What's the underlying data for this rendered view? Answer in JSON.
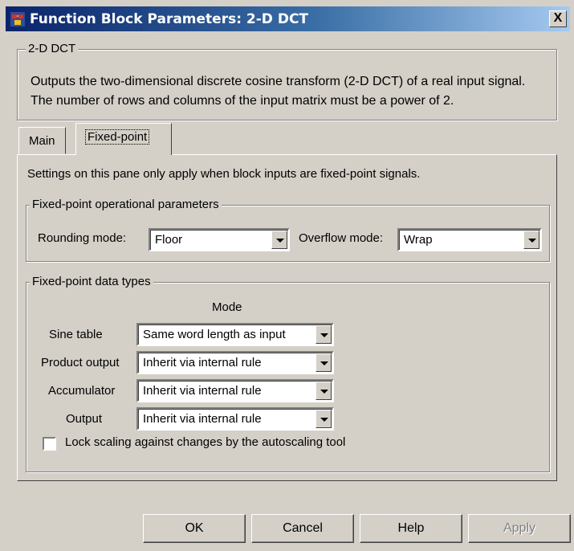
{
  "window": {
    "title": "Function Block Parameters: 2-D DCT",
    "close_label": "X"
  },
  "block": {
    "group_label": "2-D DCT",
    "description_line1": "Outputs the two-dimensional discrete cosine transform (2-D DCT) of a real input signal.",
    "description_line2": "The number of rows and columns of the input matrix must be a power of 2."
  },
  "tabs": [
    {
      "label": "Main",
      "active": false
    },
    {
      "label": "Fixed-point",
      "active": true
    }
  ],
  "pane": {
    "note": "Settings on this pane only apply when block inputs are fixed-point signals.",
    "operational": {
      "group_label": "Fixed-point operational parameters",
      "rounding_label": "Rounding mode:",
      "rounding_value": "Floor",
      "overflow_label": "Overflow mode:",
      "overflow_value": "Wrap"
    },
    "datatypes": {
      "group_label": "Fixed-point data types",
      "mode_header": "Mode",
      "rows": [
        {
          "label": "Sine table",
          "value": "Same word length as input"
        },
        {
          "label": "Product output",
          "value": "Inherit via internal rule"
        },
        {
          "label": "Accumulator",
          "value": "Inherit via internal rule"
        },
        {
          "label": "Output",
          "value": "Inherit via internal rule"
        }
      ],
      "lock_label": "Lock scaling against changes by the autoscaling tool",
      "lock_checked": false
    }
  },
  "buttons": {
    "ok": "OK",
    "cancel": "Cancel",
    "help": "Help",
    "apply": "Apply"
  }
}
